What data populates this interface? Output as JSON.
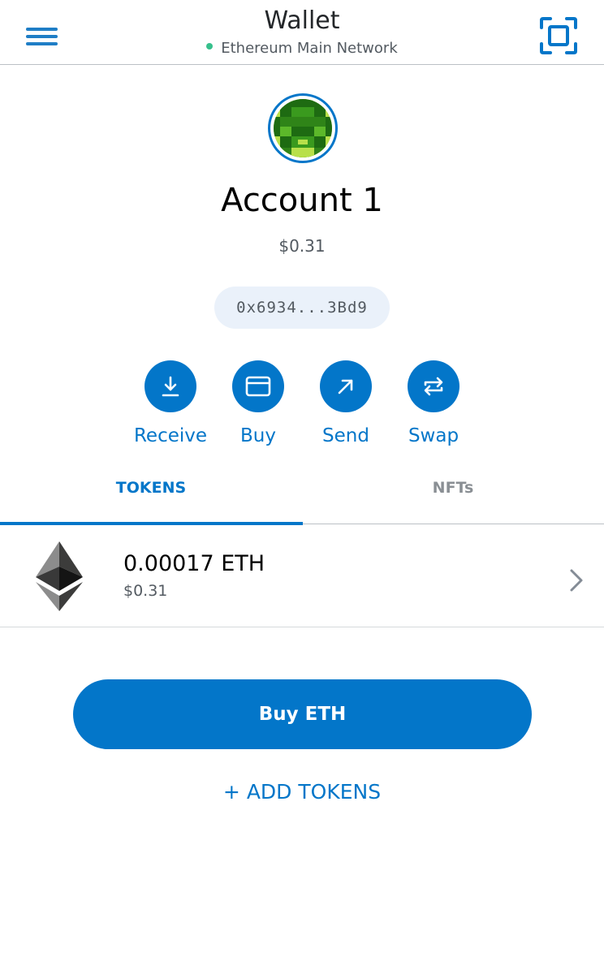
{
  "header": {
    "title": "Wallet",
    "network": "Ethereum Main Network",
    "network_status_color": "#37c08c",
    "menu_icon": "hamburger-icon",
    "scan_icon": "qr-scan-icon"
  },
  "account": {
    "name": "Account 1",
    "balance": "$0.31",
    "address": "0x6934...3Bd9",
    "avatar_icon": "identicon-avatar"
  },
  "actions": [
    {
      "label": "Receive",
      "icon": "download-icon"
    },
    {
      "label": "Buy",
      "icon": "card-icon"
    },
    {
      "label": "Send",
      "icon": "arrow-up-right-icon"
    },
    {
      "label": "Swap",
      "icon": "swap-arrows-icon"
    }
  ],
  "tabs": [
    {
      "label": "TOKENS",
      "active": true
    },
    {
      "label": "NFTs",
      "active": false
    }
  ],
  "tokens": [
    {
      "amount": "0.00017 ETH",
      "fiat": "$0.31",
      "icon": "ethereum-icon"
    }
  ],
  "buy_button": "Buy ETH",
  "add_tokens": "+ ADD TOKENS",
  "colors": {
    "accent": "#0376c9",
    "text": "#24272a",
    "muted": "#535a61",
    "address_bg": "#eaf1fa"
  }
}
